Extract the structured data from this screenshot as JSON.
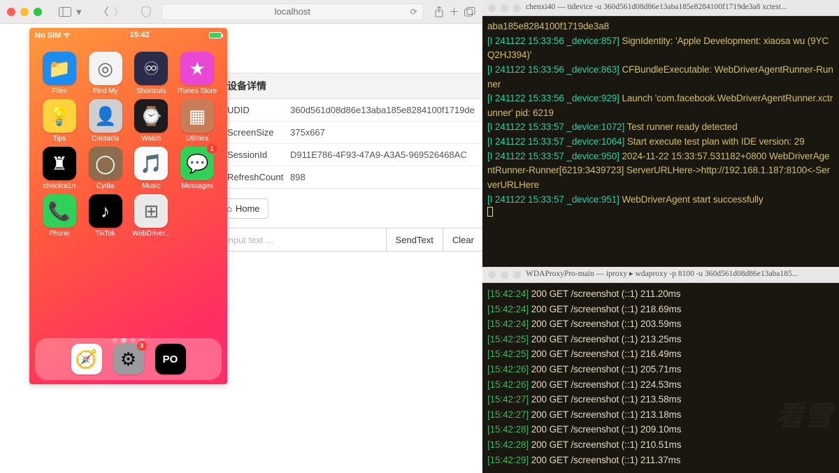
{
  "safari": {
    "url": "localhost"
  },
  "phone": {
    "carrier": "No SIM",
    "time": "15:42",
    "apps": [
      {
        "name": "Files",
        "bg": "#1d8cf1",
        "glyph": "📁"
      },
      {
        "name": "Find My",
        "bg": "#f3f3f4",
        "glyph": "◎"
      },
      {
        "name": "Shortcuts",
        "bg": "#2b2c4a",
        "glyph": "♾"
      },
      {
        "name": "iTunes Store",
        "bg": "#e948d4",
        "glyph": "★"
      },
      {
        "name": "Tips",
        "bg": "#ffd33d",
        "glyph": "💡"
      },
      {
        "name": "Contacts",
        "bg": "#cfcfd1",
        "glyph": "👤"
      },
      {
        "name": "Watch",
        "bg": "#1c1c1e",
        "glyph": "⌚"
      },
      {
        "name": "Utilities",
        "bg": "#c87c58",
        "glyph": "▦"
      },
      {
        "name": "checkra1n",
        "bg": "#000",
        "glyph": "♜"
      },
      {
        "name": "Cydia",
        "bg": "#8c6d4e",
        "glyph": "◯"
      },
      {
        "name": "Music",
        "bg": "#fafafa",
        "glyph": "🎵"
      },
      {
        "name": "Messages",
        "bg": "#30d158",
        "glyph": "💬",
        "badge": "1"
      },
      {
        "name": "Phone",
        "bg": "#30d158",
        "glyph": "📞"
      },
      {
        "name": "TikTok",
        "bg": "#000",
        "glyph": "♪"
      },
      {
        "name": "WebDriver...",
        "bg": "#e9e9ea",
        "glyph": "⊞"
      }
    ],
    "dock": [
      {
        "bg": "#fff",
        "glyph": "🧭"
      },
      {
        "bg": "#9b9b9e",
        "glyph": "⚙",
        "badge": "3"
      },
      {
        "bg": "#000",
        "glyph": "PO",
        "txt": true
      }
    ]
  },
  "details": {
    "title": "设备详情",
    "rows": [
      {
        "k": "UDID",
        "v": "360d561d08d86e13aba185e8284100f1719de"
      },
      {
        "k": "ScreenSize",
        "v": "375x667"
      },
      {
        "k": "SessionId",
        "v": "D911E786-4F93-47A9-A3A5-969526468AC"
      },
      {
        "k": "RefreshCount",
        "v": "898"
      }
    ],
    "home": "Home",
    "placeholder": "Input text ...",
    "send": "SendText",
    "clear": "Clear"
  },
  "term1": {
    "title": "chenxi40 — tidevice -u 360d561d08d86e13aba185e8284100f1719de3a8 xctest...",
    "lines": [
      {
        "pre": "",
        "txt": "aba185e8284100f1719de3a8"
      },
      {
        "pre": "[I 241122 15:33:56 _device:857]",
        "txt": " SignIdentity: 'Apple Development: xiaosa wu (9YCQ2HJ394)'"
      },
      {
        "pre": "[I 241122 15:33:56 _device:863]",
        "txt": " CFBundleExecutable: WebDriverAgentRunner-Runner"
      },
      {
        "pre": "[I 241122 15:33:56 _device:929]",
        "txt": " Launch 'com.facebook.WebDriverAgentRunner.xctrunner' pid: 6219"
      },
      {
        "pre": "[I 241122 15:33:57 _device:1072]",
        "txt": " Test runner ready detected"
      },
      {
        "pre": "[I 241122 15:33:57 _device:1064]",
        "txt": " Start execute test plan with IDE version: 29"
      },
      {
        "pre": "[I 241122 15:33:57 _device:950]",
        "txt": " 2024-11-22 15:33:57.531182+0800 WebDriverAgentRunner-Runner[6219:3439723] ServerURLHere->http://192.168.1.187:8100<-ServerURLHere"
      },
      {
        "pre": "[I 241122 15:33:57 _device:951]",
        "txt": " WebDriverAgent start successfully"
      }
    ]
  },
  "term2": {
    "title": "WDAProxyPro-main — iproxy ▸ wdaproxy -p 8100 -u 360d561d08d86e13aba185...",
    "lines": [
      {
        "ts": "[15:42:24]",
        "rest": " 200 GET /screenshot (::1) 211.20ms"
      },
      {
        "ts": "[15:42:24]",
        "rest": " 200 GET /screenshot (::1) 218.69ms"
      },
      {
        "ts": "[15:42:24]",
        "rest": " 200 GET /screenshot (::1) 203.59ms"
      },
      {
        "ts": "[15:42:25]",
        "rest": " 200 GET /screenshot (::1) 213.25ms"
      },
      {
        "ts": "[15:42:25]",
        "rest": " 200 GET /screenshot (::1) 216.49ms"
      },
      {
        "ts": "[15:42:26]",
        "rest": " 200 GET /screenshot (::1) 205.71ms"
      },
      {
        "ts": "[15:42:26]",
        "rest": " 200 GET /screenshot (::1) 224.53ms"
      },
      {
        "ts": "[15:42:27]",
        "rest": " 200 GET /screenshot (::1) 213.58ms"
      },
      {
        "ts": "[15:42:27]",
        "rest": " 200 GET /screenshot (::1) 213.18ms"
      },
      {
        "ts": "[15:42:28]",
        "rest": " 200 GET /screenshot (::1) 209.10ms"
      },
      {
        "ts": "[15:42:28]",
        "rest": " 200 GET /screenshot (::1) 210.51ms"
      },
      {
        "ts": "[15:42:29]",
        "rest": " 200 GET /screenshot (::1) 211.37ms"
      }
    ]
  }
}
